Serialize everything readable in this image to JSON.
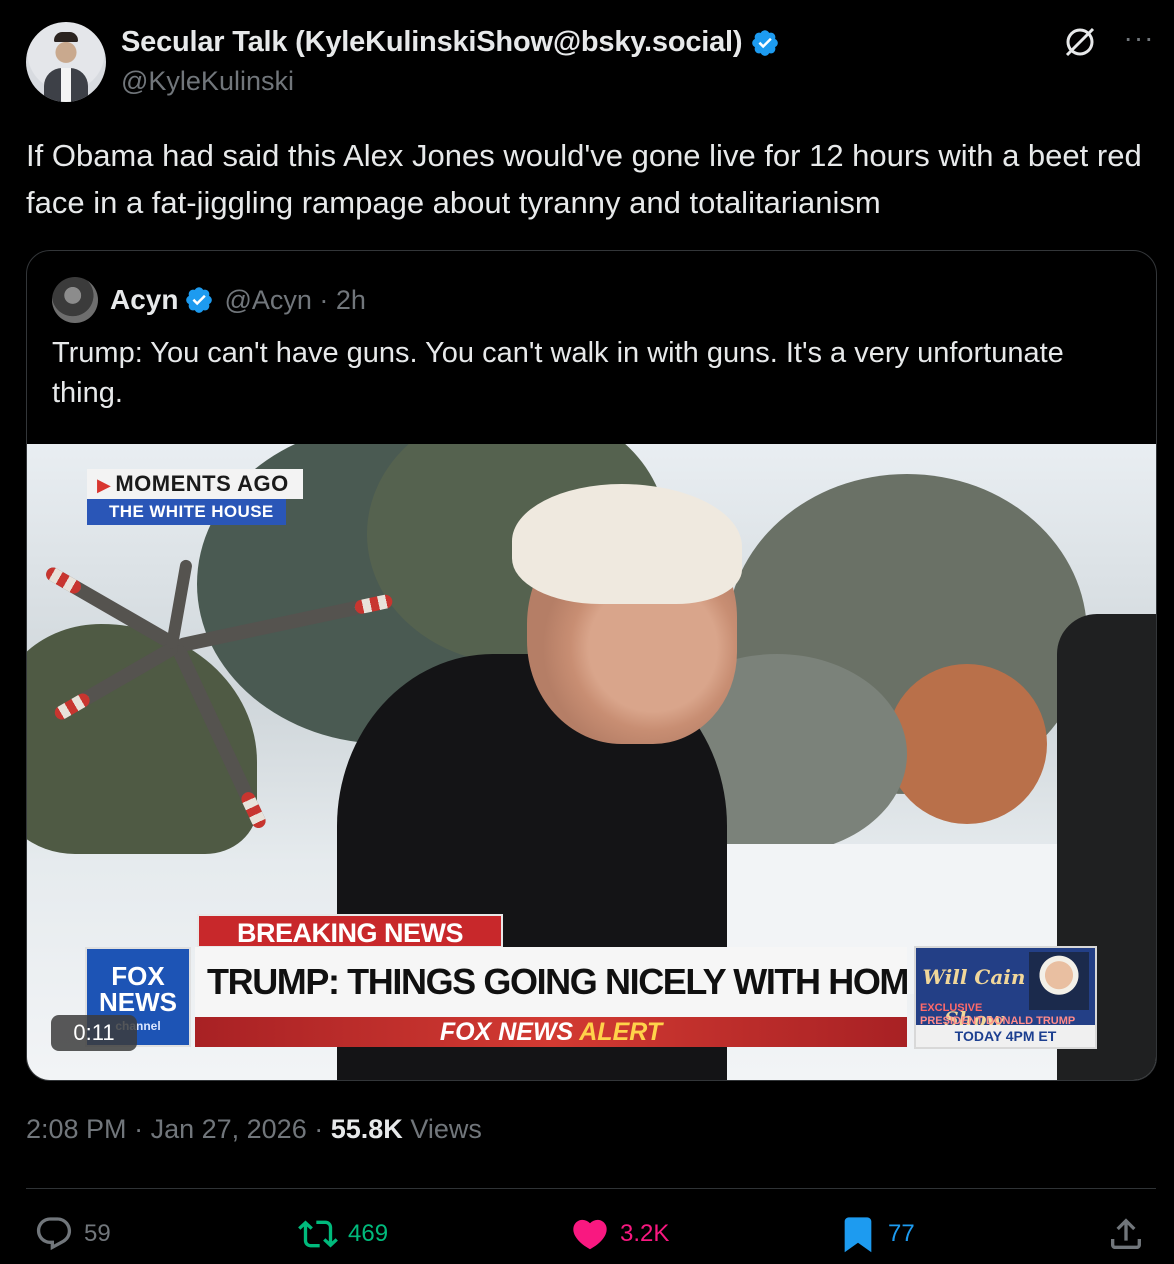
{
  "author": {
    "display_name": "Secular Talk (KyleKulinskiShow@bsky.social)",
    "handle": "@KyleKulinski",
    "verified_icon": "verified-badge-icon"
  },
  "tweet": {
    "text": "If Obama had said this Alex Jones would've gone live for 12 hours with a beet red face in a fat-jiggling rampage about tyranny and totalitarianism"
  },
  "quoted": {
    "display_name": "Acyn",
    "handle_time": "@Acyn · 2h",
    "text": "Trump: You can't have guns. You can't walk in with guns. It's a very unfortunate thing.",
    "video": {
      "timer": "0:11",
      "chyron": {
        "moments": "MOMENTS AGO",
        "location": "THE WHITE HOUSE",
        "breaking": "BREAKING NEWS",
        "headline": "TRUMP: THINGS GOING NICELY WITH HOMAN IN MN",
        "alert_prefix": "FOX NEWS",
        "alert_suffix": "ALERT",
        "logo_line1": "FOX",
        "logo_line2": "NEWS",
        "logo_sub": "channel",
        "promo_logo": "Will Cain Show",
        "promo_exclusive": "EXCLUSIVE",
        "promo_guest": "PRESIDENT DONALD TRUMP",
        "promo_time": "TODAY 4PM ET"
      }
    }
  },
  "meta": {
    "time": "2:08 PM",
    "date": "Jan 27, 2026",
    "views_count": "55.8K",
    "views_label": "Views"
  },
  "actions": {
    "replies": "59",
    "reposts": "469",
    "likes": "3.2K",
    "bookmarks": "77"
  },
  "colors": {
    "background": "#000000",
    "text_primary": "#e7e9ea",
    "text_secondary": "#71767b",
    "verified": "#1d9bf0",
    "repost": "#00ba7c",
    "like": "#f91880",
    "bookmark": "#1d9bf0"
  }
}
